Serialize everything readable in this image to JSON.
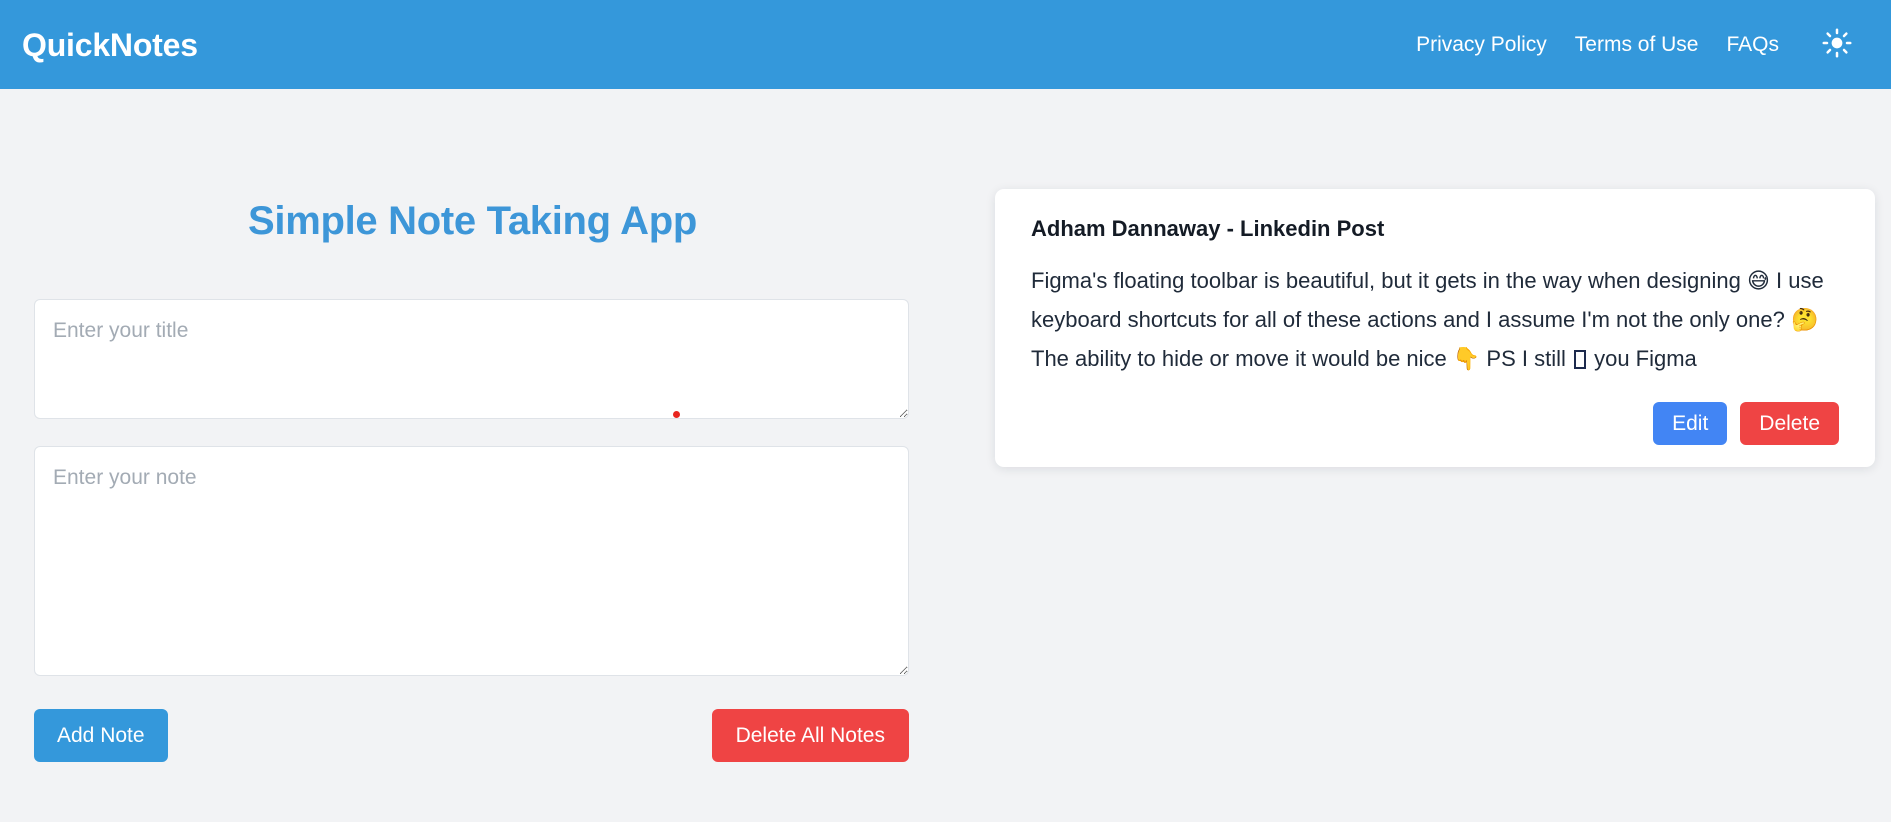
{
  "header": {
    "brand": "QuickNotes",
    "nav": [
      {
        "label": "Privacy Policy",
        "name": "nav-link-privacy-policy"
      },
      {
        "label": "Terms of Use",
        "name": "nav-link-terms-of-use"
      },
      {
        "label": "FAQs",
        "name": "nav-link-faqs"
      }
    ],
    "theme_toggle_icon": "sun-icon",
    "background_color": "#3498db"
  },
  "main": {
    "page_title": "Simple Note Taking App",
    "page_title_color": "#3d96d8",
    "title_input": {
      "value": "",
      "placeholder": "Enter your title"
    },
    "note_input": {
      "value": "",
      "placeholder": "Enter your note"
    },
    "add_note_label": "Add Note",
    "add_note_color": "#3498db",
    "delete_all_label": "Delete All Notes",
    "delete_all_color": "#ef4444",
    "cursor_marker_color": "#e8261f"
  },
  "notes": [
    {
      "title": "Adham Dannaway - Linkedin Post",
      "body_part_1": "Figma's floating toolbar is beautiful, but it gets in the way when designing 😅 I use keyboard shortcuts for all of these actions and I assume I'm not the only one? 🤔 The ability to hide or move it would be nice 👇 PS I still ",
      "body_part_2": " you Figma",
      "edit_label": "Edit",
      "edit_color": "#4285f4",
      "delete_label": "Delete",
      "delete_color": "#ef4444"
    }
  ],
  "page": {
    "background_color": "#f2f3f5"
  }
}
